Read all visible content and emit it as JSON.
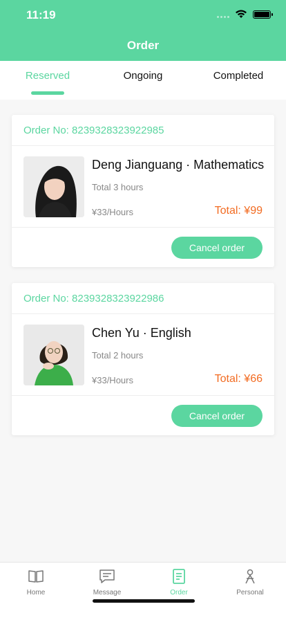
{
  "status": {
    "time": "11:19"
  },
  "header": {
    "title": "Order"
  },
  "tabs": [
    {
      "label": "Reserved",
      "active": true
    },
    {
      "label": "Ongoing",
      "active": false
    },
    {
      "label": "Completed",
      "active": false
    }
  ],
  "orders": [
    {
      "order_no": "Order No: 8239328323922985",
      "teacher": "Deng Jianguang · Mathematics",
      "hours": "Total 3 hours",
      "rate": "¥33/Hours",
      "total": "Total: ¥99",
      "action": "Cancel order"
    },
    {
      "order_no": "Order No: 8239328323922986",
      "teacher": "Chen Yu · English",
      "hours": "Total 2 hours",
      "rate": "¥33/Hours",
      "total": "Total: ¥66",
      "action": "Cancel order"
    }
  ],
  "tabbar": [
    {
      "label": "Home",
      "icon": "book-icon"
    },
    {
      "label": "Message",
      "icon": "message-icon"
    },
    {
      "label": "Order",
      "icon": "order-icon",
      "active": true
    },
    {
      "label": "Personal",
      "icon": "person-icon"
    }
  ],
  "colors": {
    "accent": "#5bd6a0",
    "price": "#f26b21"
  }
}
